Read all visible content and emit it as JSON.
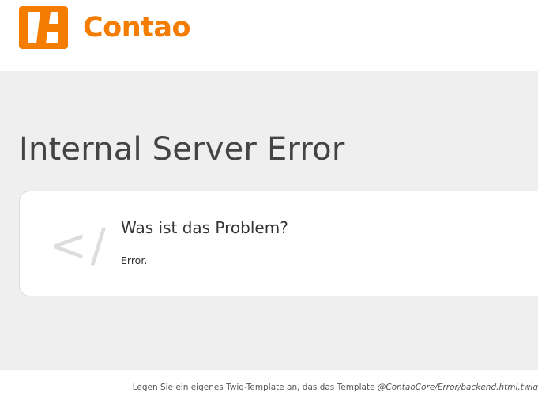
{
  "header": {
    "logo_text": "Contao",
    "brand_color": "#f47c00"
  },
  "main": {
    "title": "Internal Server Error",
    "card": {
      "icon": "code-icon",
      "icon_glyph": "</",
      "heading": "Was ist das Problem?",
      "text": "Error."
    }
  },
  "footer": {
    "note_prefix": "Legen Sie ein eigenes Twig-Template an, das das Template ",
    "template_path": "@ContaoCore/Error/backend.html.twig"
  }
}
